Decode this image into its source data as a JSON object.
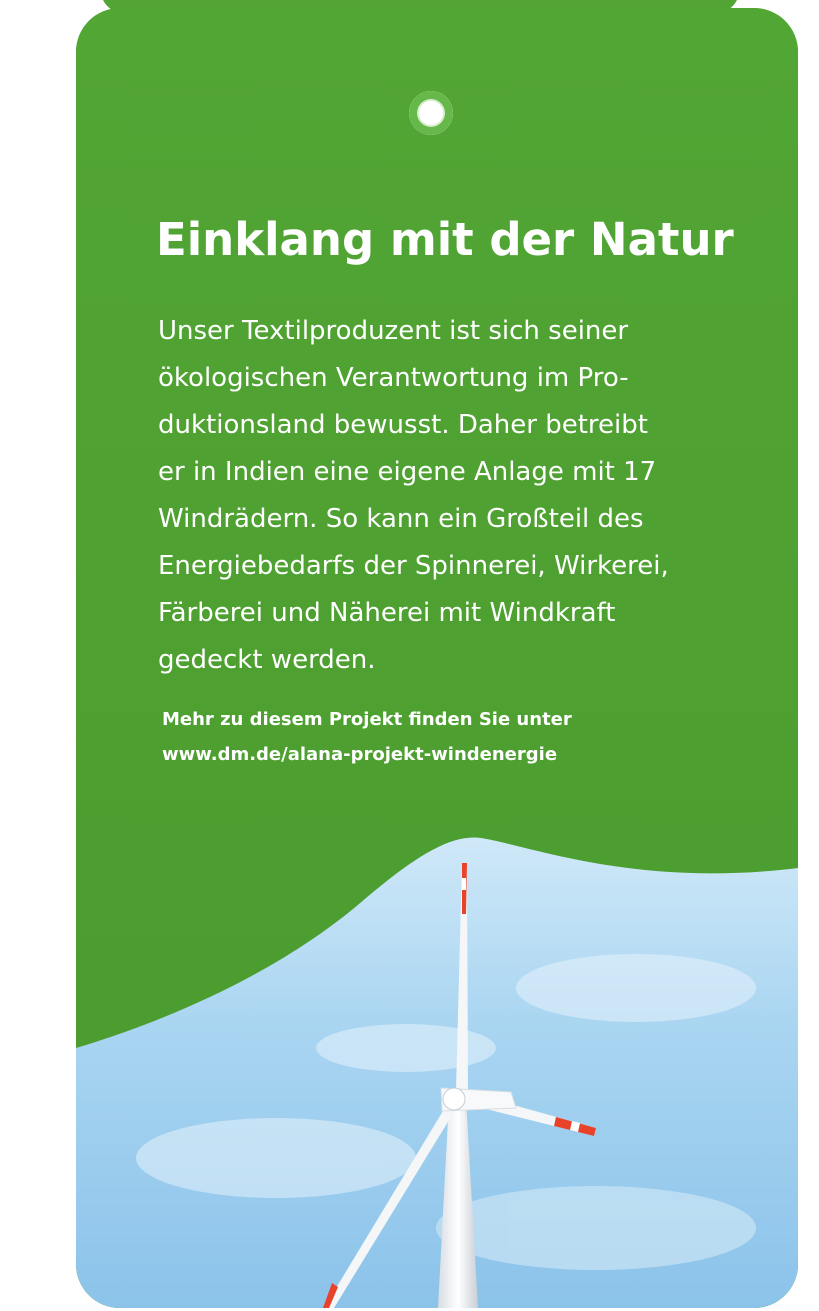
{
  "tag": {
    "title": "Einklang mit der Natur",
    "body_lines": [
      "Unser Textilproduzent ist sich seiner",
      "ökologischen Verantwortung im Pro-",
      "duktionsland bewusst. Daher betreibt",
      "er in Indien eine eigene Anlage mit 17",
      "Windrädern. So kann ein Großteil des",
      "Energiebedarfs der Spinnerei, Wirkerei,",
      "Färberei und Näherei mit Windkraft",
      "gedeckt werden."
    ],
    "info_lines": [
      "Mehr zu diesem Projekt finden Sie unter",
      "www.dm.de/alana-projekt-windenergie"
    ]
  },
  "colors": {
    "green": "#4fa131",
    "sky": "#9fcfef",
    "text": "#ffffff",
    "blade_tip": "#e8432a"
  }
}
